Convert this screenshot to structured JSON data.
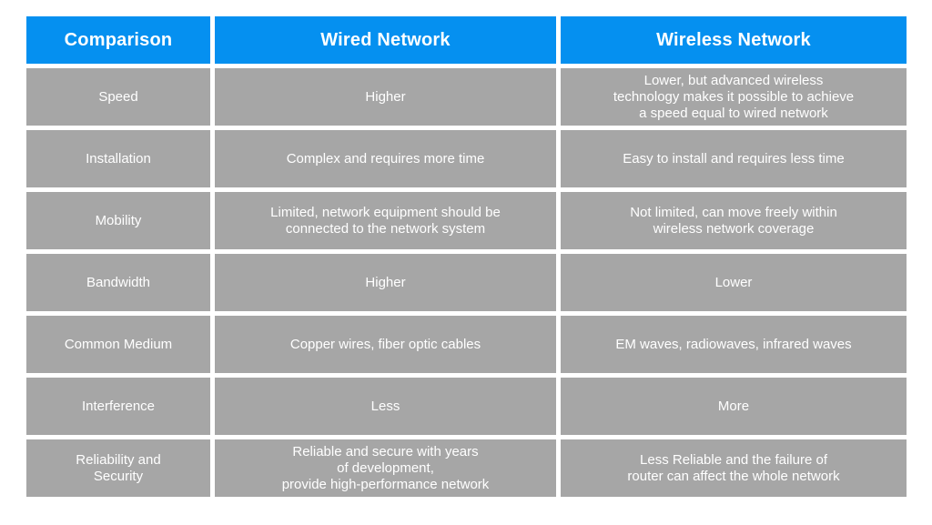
{
  "table": {
    "headers": [
      {
        "label": "Comparison"
      },
      {
        "label": "Wired Network"
      },
      {
        "label": "Wireless Network"
      }
    ],
    "colors": {
      "header_background": "#0590f0",
      "header_text": "#ffffff",
      "cell_background": "#a6a6a6",
      "cell_text": "#ffffff",
      "page_background": "#ffffff"
    },
    "rows": [
      {
        "label": "Speed",
        "label_lines": [
          "Speed"
        ],
        "wired": "Higher",
        "wired_lines": [
          "Higher"
        ],
        "wireless": "Lower, but advanced wireless technology makes it possible to achieve a speed equal to wired network",
        "wireless_lines": [
          "Lower, but advanced wireless",
          "technology makes it possible to achieve",
          "a speed equal to wired network"
        ]
      },
      {
        "label": "Installation",
        "label_lines": [
          "Installation"
        ],
        "wired": "Complex and requires more time",
        "wired_lines": [
          "Complex and requires more time"
        ],
        "wireless": "Easy to install and requires less time",
        "wireless_lines": [
          "Easy to install and requires less time"
        ]
      },
      {
        "label": "Mobility",
        "label_lines": [
          "Mobility"
        ],
        "wired": "Limited, network equipment should be connected to the network system",
        "wired_lines": [
          "Limited, network equipment should be",
          "connected to the network system"
        ],
        "wireless": "Not limited, can move freely within wireless network coverage",
        "wireless_lines": [
          "Not limited, can move freely within",
          "wireless network coverage"
        ]
      },
      {
        "label": "Bandwidth",
        "label_lines": [
          "Bandwidth"
        ],
        "wired": "Higher",
        "wired_lines": [
          "Higher"
        ],
        "wireless": "Lower",
        "wireless_lines": [
          "Lower"
        ]
      },
      {
        "label": "Common Medium",
        "label_lines": [
          "Common Medium"
        ],
        "wired": "Copper wires, fiber optic cables",
        "wired_lines": [
          "Copper wires, fiber optic cables"
        ],
        "wireless": "EM waves, radiowaves, infrared waves",
        "wireless_lines": [
          "EM waves, radiowaves, infrared waves"
        ]
      },
      {
        "label": "Interference",
        "label_lines": [
          "Interference"
        ],
        "wired": "Less",
        "wired_lines": [
          "Less"
        ],
        "wireless": "More",
        "wireless_lines": [
          "More"
        ]
      },
      {
        "label": "Reliability and Security",
        "label_lines": [
          "Reliability and",
          "Security"
        ],
        "wired": "Reliable and secure with years of development, provide high-performance network",
        "wired_lines": [
          "Reliable and secure with years",
          "of development,",
          "provide high-performance network"
        ],
        "wireless": "Less Reliable and the failure of router can affect the whole network",
        "wireless_lines": [
          "Less Reliable and the failure of",
          "router can affect the whole network"
        ]
      }
    ]
  }
}
